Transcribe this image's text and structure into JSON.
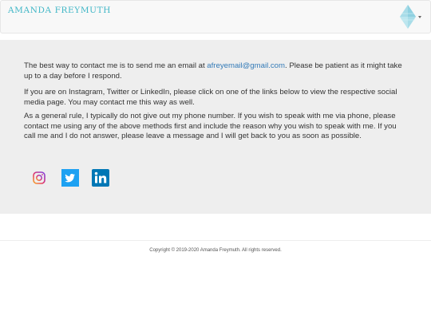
{
  "header": {
    "brand": "AMANDA FREYMUTH",
    "logo_icon": "diamond-logo-icon",
    "dropdown_icon": "caret-down-icon",
    "brand_color": "#3fb6c6"
  },
  "contact": {
    "p1_before": "The best way to contact me is to send me an email at ",
    "email": "afreyemail@gmail.com",
    "p1_after": ". Please be patient as it might take up to a day before I respond.",
    "p2": "If you are on Instagram, Twitter or LinkedIn, please click on one of the links below to view the respective social media page. You may contact me this way as well.",
    "p3": "As a general rule, I typically do not give out my phone number. If you wish to speak with me via phone, please contact me using any of the above methods first and include the reason why you wish to speak with me. If you call me and I do not answer, please leave a message and I will get back to you as soon as possible."
  },
  "social": [
    {
      "icon": "instagram-icon"
    },
    {
      "icon": "twitter-icon",
      "color": "#1da1f2"
    },
    {
      "icon": "linkedin-icon",
      "color": "#0077b5"
    }
  ],
  "footer": {
    "copyright": "Copyright © 2019-2020 Amanda Freymuth. All rights reserved."
  },
  "colors": {
    "section_bg": "#eeeeee",
    "link": "#337ab7"
  }
}
